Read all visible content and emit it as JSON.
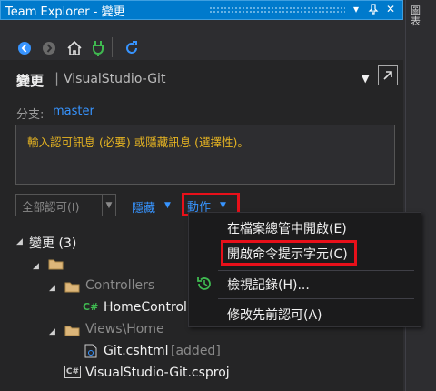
{
  "window": {
    "title": "Team Explorer - 變更",
    "dropdown_glyph": "▾",
    "pin_glyph": "ᛘ",
    "close_glyph": "✕"
  },
  "side_panel": {
    "label": "圖\n表"
  },
  "toolbar": {
    "icons": [
      "back-icon",
      "forward-icon",
      "home-icon",
      "plug-icon",
      "refresh-icon"
    ]
  },
  "header": {
    "title": "變更",
    "separator": "|",
    "repo": "VisualStudio-Git",
    "dropdown_glyph": "▼"
  },
  "branch": {
    "label": "分支:",
    "name": "master"
  },
  "commit": {
    "placeholder": "輸入認可訊息 (必要) 或隱藏訊息 (選擇性)。",
    "commit_all_label": "全部認可(I)",
    "commit_all_dd": "▼",
    "hide_label": "隱藏",
    "actions_label": "動作",
    "arrow": "▼"
  },
  "tree": {
    "section_label": "變更 (3)",
    "items": [
      {
        "label": "Controllers"
      },
      {
        "label": "HomeControl",
        "badge": "C#"
      },
      {
        "label": "Views\\Home"
      },
      {
        "label": "Git.cshtml",
        "status": "[added]"
      },
      {
        "label": "VisualStudio-Git.csproj",
        "badge": "C#"
      }
    ]
  },
  "menu": {
    "items": [
      {
        "label": "在檔案總管中開啟(E)"
      },
      {
        "label": "開啟命令提示字元(C)"
      },
      {
        "label": "檢視記錄(H)..."
      },
      {
        "label": "修改先前認可(A)"
      }
    ]
  },
  "colors": {
    "accent": "#007acc",
    "link": "#3794ff",
    "highlight_box": "#e8101a",
    "placeholder": "#e6b422",
    "history_icon": "#3fb950"
  }
}
